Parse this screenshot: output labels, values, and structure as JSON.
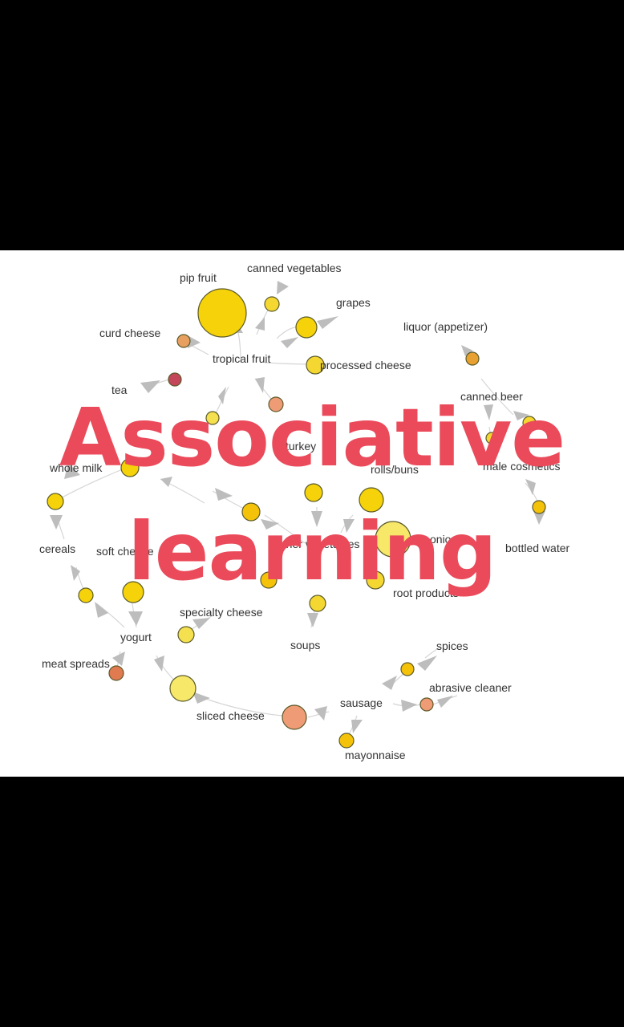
{
  "overlay": {
    "line1": "Associative",
    "line2": "learning",
    "color": "#ea4a5a"
  },
  "colors": {
    "background": "#000000",
    "panel": "#ffffff",
    "edge": "#bdbdbd",
    "node_bright": "#f5d20a",
    "node_pale": "#f7e86a",
    "node_orange": "#e8a060",
    "node_salmon": "#ef9b76",
    "node_red": "#c4465a"
  },
  "labels": {
    "pip_fruit": "pip fruit",
    "canned_vegetables": "canned vegetables",
    "grapes": "grapes",
    "curd_cheese": "curd cheese",
    "tropical_fruit": "tropical fruit",
    "processed_cheese": "processed cheese",
    "liquor_appetizer": "liquor (appetizer)",
    "tea": "tea",
    "canned_beer": "canned beer",
    "whole_milk": "whole milk",
    "turkey": "turkey",
    "rolls_buns": "rolls/buns",
    "male_cosmetics": "male cosmetics",
    "cereals": "cereals",
    "soft_cheese": "soft cheese",
    "other_vegetables": "other vegetables",
    "onions": "onions",
    "bottled_water": "bottled water",
    "root_vegetables": "root products",
    "specialty_cheese": "specialty cheese",
    "yogurt": "yogurt",
    "soups": "soups",
    "spices": "spices",
    "meat_spreads": "meat spreads",
    "abrasive_cleaner": "abrasive cleaner",
    "sausage": "sausage",
    "sliced_cheese": "sliced cheese",
    "mayonnaise": "mayonnaise"
  }
}
